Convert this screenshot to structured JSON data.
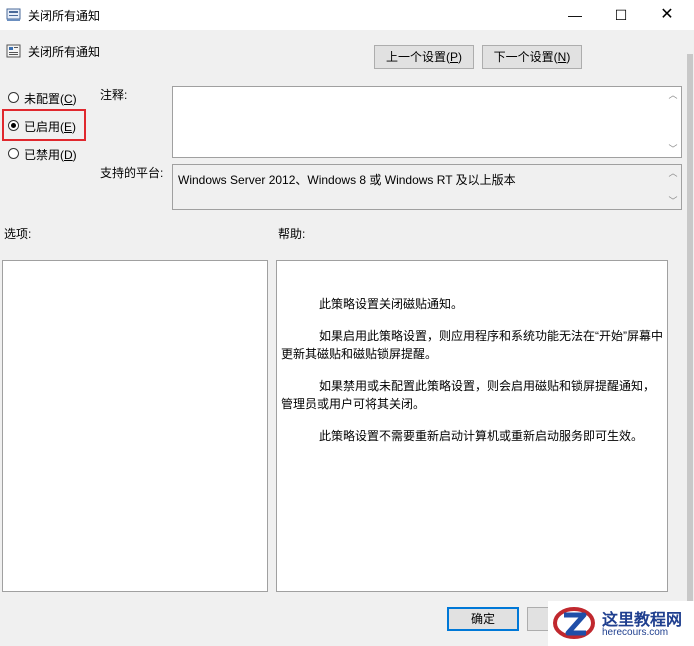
{
  "window": {
    "title": "关闭所有通知",
    "icon": "policy-icon",
    "controls": {
      "minimize": "—",
      "maximize": "☐",
      "close": "✕"
    }
  },
  "header": {
    "policy_name": "关闭所有通知",
    "prev_button": {
      "text": "上一个设置(",
      "key": "P",
      "end": ")"
    },
    "next_button": {
      "text": "下一个设置(",
      "key": "N",
      "end": ")"
    }
  },
  "state_options": [
    {
      "text": "未配置(",
      "key": "C",
      "end": ")",
      "selected": false
    },
    {
      "text": "已启用(",
      "key": "E",
      "end": ")",
      "selected": true
    },
    {
      "text": "已禁用(",
      "key": "D",
      "end": ")",
      "selected": false
    }
  ],
  "comment": {
    "label": "注释:",
    "value": ""
  },
  "platform": {
    "label": "支持的平台:",
    "value": "Windows Server 2012、Windows 8 或 Windows RT 及以上版本"
  },
  "options_section": {
    "label": "选项:"
  },
  "help_section": {
    "label": "帮助:",
    "paragraphs": [
      "此策略设置关闭磁贴通知。",
      "如果启用此策略设置，则应用程序和系统功能无法在“开始”屏幕中更新其磁贴和磁贴锁屏提醒。",
      "如果禁用或未配置此策略设置，则会启用磁贴和锁屏提醒通知，管理员或用户可将其关闭。",
      "此策略设置不需要重新启动计算机或重新启动服务即可生效。"
    ]
  },
  "footer": {
    "ok_label": "确定"
  },
  "watermark": {
    "name": "这里教程网",
    "url": "herecours.com"
  },
  "colors": {
    "highlight": "#e0282e",
    "accent": "#0078d7"
  }
}
